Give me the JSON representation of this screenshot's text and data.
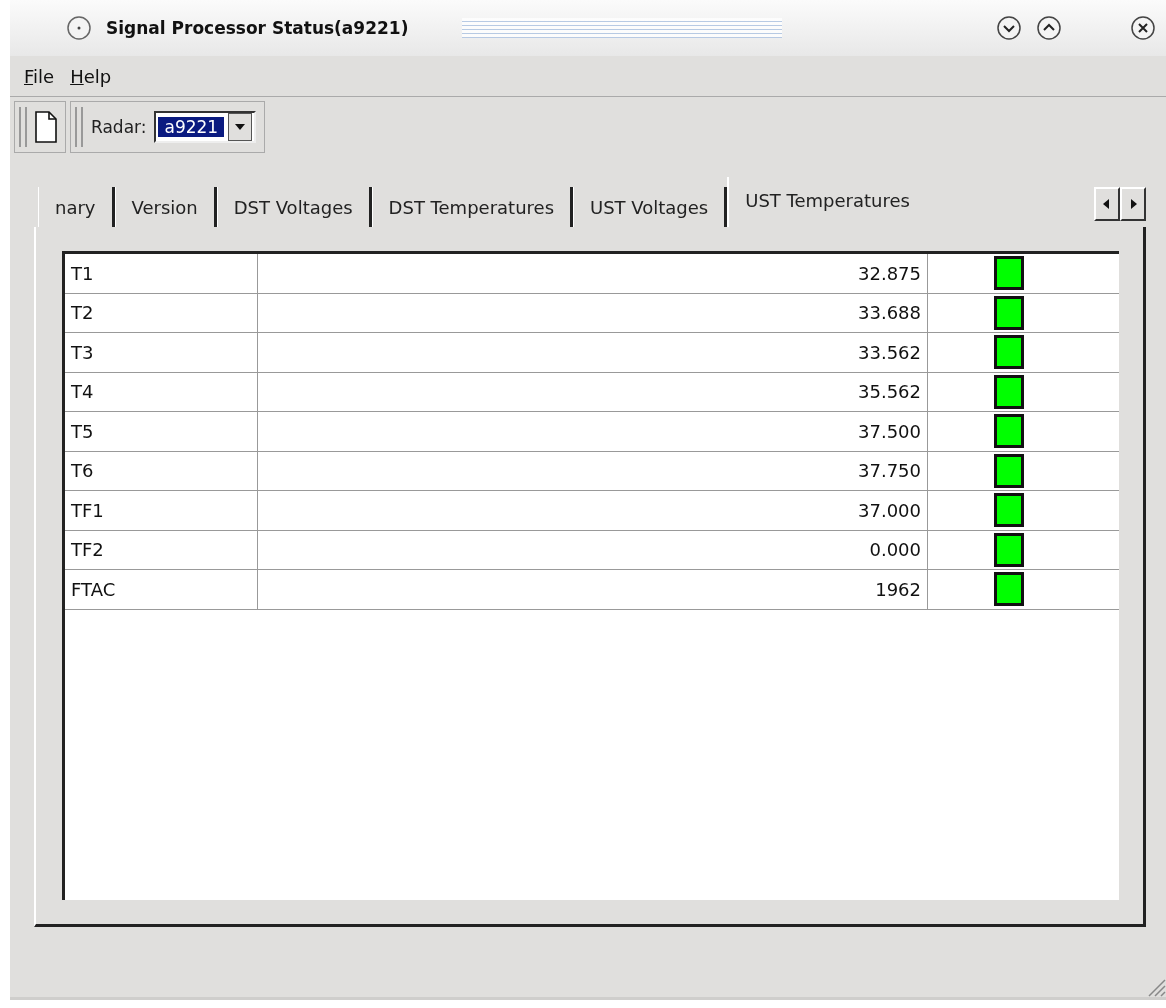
{
  "window": {
    "title": "Signal Processor Status(a9221)"
  },
  "menu": [
    {
      "mnemonic": "F",
      "rest": "ile"
    },
    {
      "mnemonic": "H",
      "rest": "elp"
    }
  ],
  "toolbar": {
    "radar_label": "Radar:",
    "radar_value": "a9221"
  },
  "tabs": [
    {
      "label": "nary",
      "selected": false
    },
    {
      "label": "Version",
      "selected": false
    },
    {
      "label": "DST Voltages",
      "selected": false
    },
    {
      "label": "DST Temperatures",
      "selected": false
    },
    {
      "label": "UST Voltages",
      "selected": false
    },
    {
      "label": "UST Temperatures",
      "selected": true
    }
  ],
  "rows": [
    {
      "name": "T1",
      "value": "32.875",
      "color": "#00ff00"
    },
    {
      "name": "T2",
      "value": "33.688",
      "color": "#00ff00"
    },
    {
      "name": "T3",
      "value": "33.562",
      "color": "#00ff00"
    },
    {
      "name": "T4",
      "value": "35.562",
      "color": "#00ff00"
    },
    {
      "name": "T5",
      "value": "37.500",
      "color": "#00ff00"
    },
    {
      "name": "T6",
      "value": "37.750",
      "color": "#00ff00"
    },
    {
      "name": "TF1",
      "value": "37.000",
      "color": "#00ff00"
    },
    {
      "name": "TF2",
      "value": "0.000",
      "color": "#00ff00"
    },
    {
      "name": "FTAC",
      "value": "1962",
      "color": "#00ff00"
    }
  ]
}
